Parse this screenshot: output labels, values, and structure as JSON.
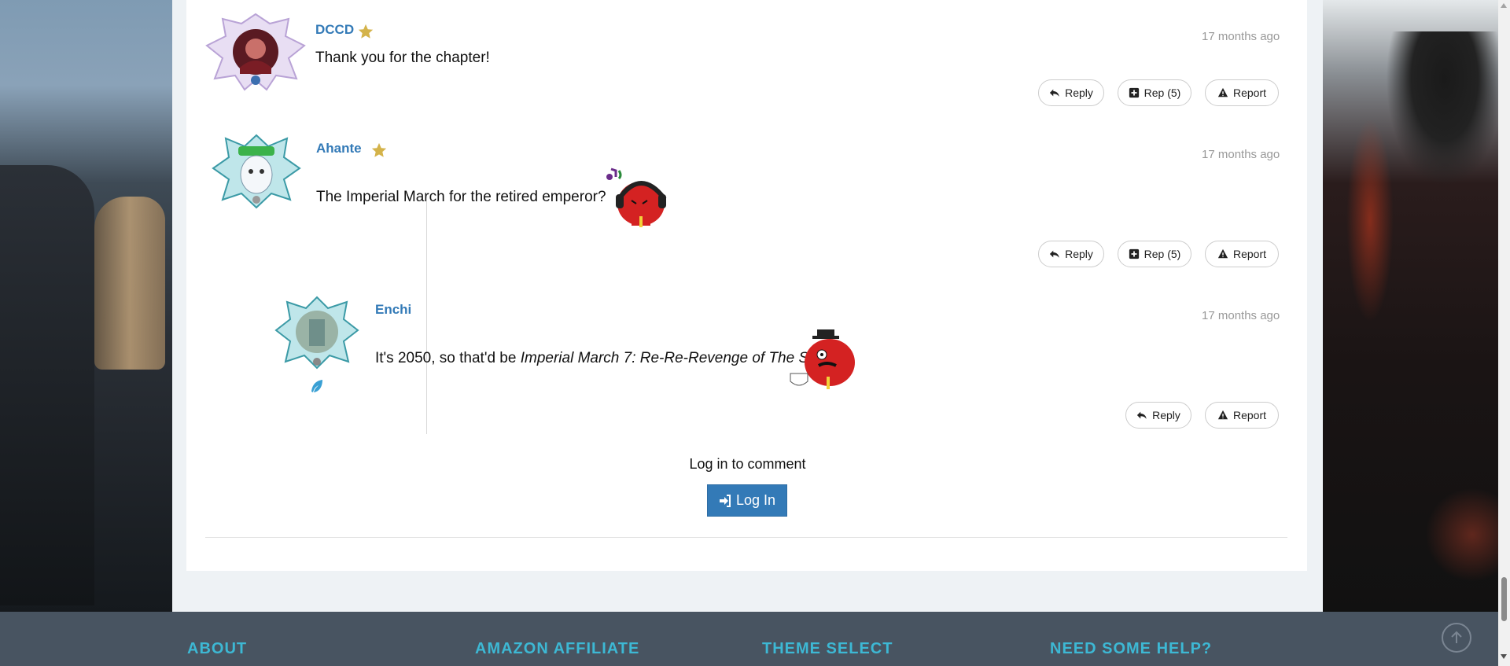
{
  "comments": [
    {
      "username": "DCCD",
      "time": "17 months ago",
      "text": "Thank you for the chapter!",
      "reply_label": "Reply",
      "rep_label": "Rep (5)",
      "report_label": "Report"
    },
    {
      "username": "Ahante",
      "time": "17 months ago",
      "text": "The Imperial March for the retired emperor?",
      "reply_label": "Reply",
      "rep_label": "Rep (5)",
      "report_label": "Report"
    },
    {
      "username": "Enchi",
      "time": "17 months ago",
      "text_plain": "It's 2050, so that'd be ",
      "text_italic": "Imperial March 7: Re-Re-Revenge of The Sith",
      "text_end": ".",
      "reply_label": "Reply",
      "report_label": "Report"
    }
  ],
  "login": {
    "prompt": "Log in to comment",
    "button_label": "Log In"
  },
  "footer": {
    "headings": [
      "ABOUT",
      "AMAZON AFFILIATE",
      "THEME SELECT",
      "NEED SOME HELP?"
    ]
  },
  "colors": {
    "link": "#337ab7",
    "star": "#d4b34a",
    "footer_bg": "#485461",
    "footer_heading": "#3db8d4",
    "button_primary": "#337ab7"
  },
  "icons": [
    "reply-icon",
    "plus-square-icon",
    "warning-icon",
    "star-icon",
    "login-icon",
    "feather-icon",
    "arrow-up-circle-icon"
  ]
}
